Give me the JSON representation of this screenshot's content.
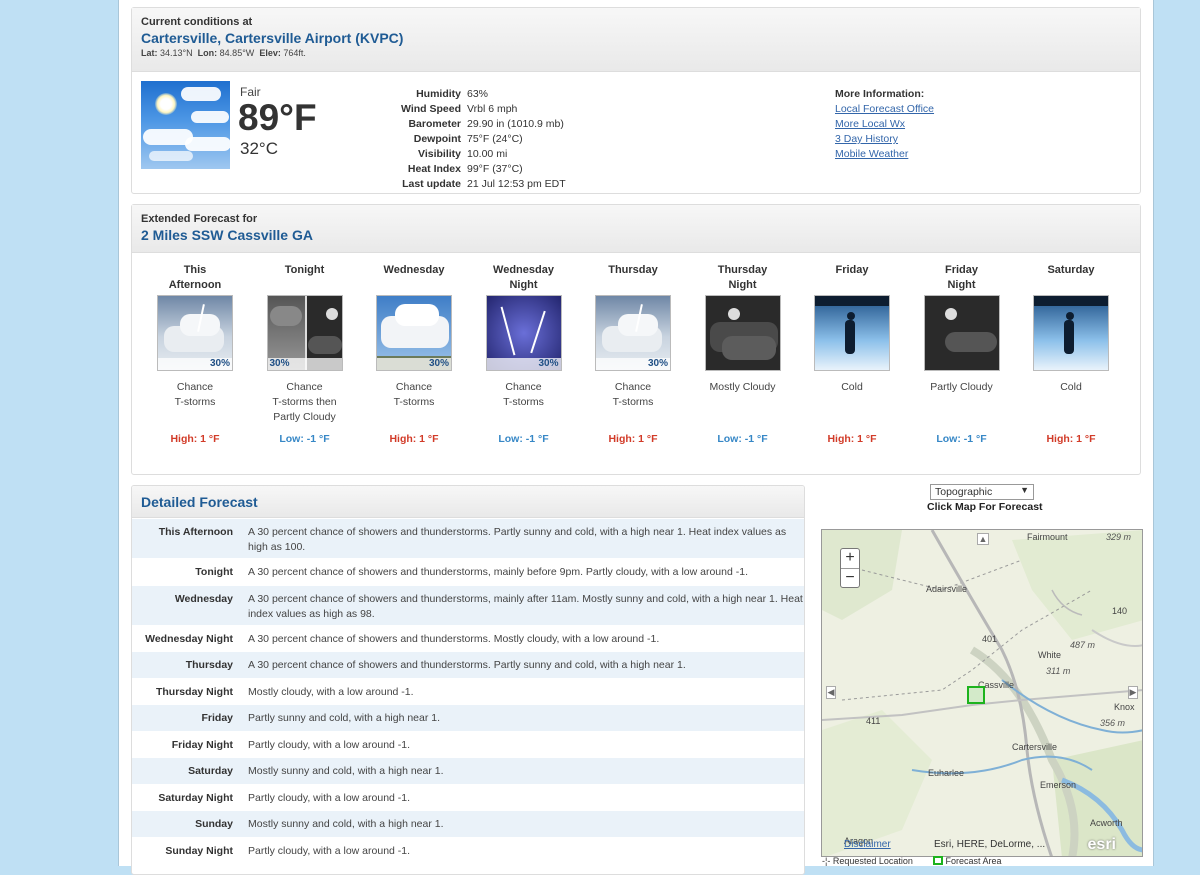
{
  "current": {
    "label": "Current conditions at",
    "station": "Cartersville, Cartersville Airport (KVPC)",
    "lat_label": "Lat:",
    "lat": "34.13°N",
    "lon_label": "Lon:",
    "lon": "84.85°W",
    "elev_label": "Elev:",
    "elev": "764ft.",
    "summary": "Fair",
    "temp_f": "89°F",
    "temp_c": "32°C",
    "details": [
      {
        "k": "Humidity",
        "v": "63%"
      },
      {
        "k": "Wind Speed",
        "v": "Vrbl 6 mph"
      },
      {
        "k": "Barometer",
        "v": "29.90 in (1010.9 mb)"
      },
      {
        "k": "Dewpoint",
        "v": "75°F (24°C)"
      },
      {
        "k": "Visibility",
        "v": "10.00 mi"
      },
      {
        "k": "Heat Index",
        "v": "99°F (37°C)"
      },
      {
        "k": "Last update",
        "v": "21 Jul 12:53 pm EDT"
      }
    ],
    "more_info_title": "More Information:",
    "links": [
      "Local Forecast Office",
      "More Local Wx",
      "3 Day History",
      "Mobile Weather"
    ]
  },
  "extended": {
    "label": "Extended Forecast for",
    "location": "2 Miles SSW Cassville GA",
    "periods": [
      {
        "name1": "This",
        "name2": "Afternoon",
        "pop": "30%",
        "short": [
          "Chance",
          "T-storms"
        ],
        "temp": "High: 1 °F",
        "kind": "hi",
        "icon": "thunderstorm-day"
      },
      {
        "name1": "Tonight",
        "name2": "",
        "pop": "30%",
        "short": [
          "Chance",
          "T-storms then",
          "Partly Cloudy"
        ],
        "temp": "Low: -1 °F",
        "kind": "lo",
        "icon": "tstorm-then-night"
      },
      {
        "name1": "Wednesday",
        "name2": "",
        "pop": "30%",
        "short": [
          "Chance",
          "T-storms"
        ],
        "temp": "High: 1 °F",
        "kind": "hi",
        "icon": "tstorm-cumulus-day"
      },
      {
        "name1": "Wednesday",
        "name2": "Night",
        "pop": "30%",
        "short": [
          "Chance",
          "T-storms"
        ],
        "temp": "Low: -1 °F",
        "kind": "lo",
        "icon": "lightning-night"
      },
      {
        "name1": "Thursday",
        "name2": "",
        "pop": "30%",
        "short": [
          "Chance",
          "T-storms"
        ],
        "temp": "High: 1 °F",
        "kind": "hi",
        "icon": "thunderstorm-day"
      },
      {
        "name1": "Thursday",
        "name2": "Night",
        "pop": "",
        "short": [
          "Mostly Cloudy"
        ],
        "temp": "Low: -1 °F",
        "kind": "lo",
        "icon": "cloudy-night"
      },
      {
        "name1": "Friday",
        "name2": "",
        "pop": "",
        "short": [
          "Cold"
        ],
        "temp": "High: 1 °F",
        "kind": "hi",
        "icon": "cold"
      },
      {
        "name1": "Friday",
        "name2": "Night",
        "pop": "",
        "short": [
          "Partly Cloudy"
        ],
        "temp": "Low: -1 °F",
        "kind": "lo",
        "icon": "partly-cloudy-night"
      },
      {
        "name1": "Saturday",
        "name2": "",
        "pop": "",
        "short": [
          "Cold"
        ],
        "temp": "High: 1 °F",
        "kind": "hi",
        "icon": "cold"
      }
    ]
  },
  "detailed": {
    "title": "Detailed Forecast",
    "rows": [
      {
        "k": "This Afternoon",
        "v": "A 30 percent chance of showers and thunderstorms. Partly sunny and cold, with a high near 1. Heat index values as high as 100."
      },
      {
        "k": "Tonight",
        "v": "A 30 percent chance of showers and thunderstorms, mainly before 9pm. Partly cloudy, with a low around -1."
      },
      {
        "k": "Wednesday",
        "v": "A 30 percent chance of showers and thunderstorms, mainly after 11am. Mostly sunny and cold, with a high near 1. Heat index values as high as 98."
      },
      {
        "k": "Wednesday Night",
        "v": "A 30 percent chance of showers and thunderstorms. Mostly cloudy, with a low around -1."
      },
      {
        "k": "Thursday",
        "v": "A 30 percent chance of showers and thunderstorms. Partly sunny and cold, with a high near 1."
      },
      {
        "k": "Thursday Night",
        "v": "Mostly cloudy, with a low around -1."
      },
      {
        "k": "Friday",
        "v": "Partly sunny and cold, with a high near 1."
      },
      {
        "k": "Friday Night",
        "v": "Partly cloudy, with a low around -1."
      },
      {
        "k": "Saturday",
        "v": "Mostly sunny and cold, with a high near 1."
      },
      {
        "k": "Saturday Night",
        "v": "Partly cloudy, with a low around -1."
      },
      {
        "k": "Sunday",
        "v": "Mostly sunny and cold, with a high near 1."
      },
      {
        "k": "Sunday Night",
        "v": "Partly cloudy, with a low around -1."
      }
    ]
  },
  "map": {
    "basemap_selected": "Topographic",
    "caption": "Click Map For Forecast",
    "places": [
      "Fairmount",
      "Adairsville",
      "White",
      "Cassville",
      "Cartersville",
      "Emerson",
      "Euharlee",
      "Acworth",
      "Aragon",
      "Knox"
    ],
    "elevations": [
      "329 m",
      "487 m",
      "311 m",
      "356 m"
    ],
    "roads": [
      "140",
      "401",
      "411"
    ],
    "attribution": "Esri, HERE, DeLorme, ...",
    "disclaimer": "Disclaimer",
    "logo": "esri",
    "legend": [
      "Requested Location",
      "Forecast Area"
    ]
  },
  "colors": {
    "link": "#3366aa",
    "title": "#1f5b94",
    "high": "#d23b28",
    "low": "#3687c6",
    "page_bg": "#bfe0f4"
  }
}
